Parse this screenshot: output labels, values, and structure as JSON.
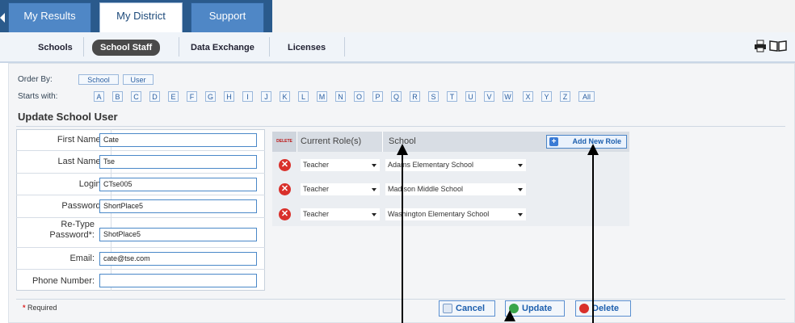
{
  "tabs": [
    {
      "label": "My Results",
      "active": false
    },
    {
      "label": "My District",
      "active": true
    },
    {
      "label": "Support",
      "active": false
    }
  ],
  "subnav": [
    "Schools",
    "School Staff",
    "Data Exchange",
    "Licenses"
  ],
  "subnav_active": "School Staff",
  "order_by": {
    "label": "Order By:",
    "options": [
      "School",
      "User"
    ]
  },
  "starts_with": {
    "label": "Starts with:",
    "letters": [
      "A",
      "B",
      "C",
      "D",
      "E",
      "F",
      "G",
      "H",
      "I",
      "J",
      "K",
      "L",
      "M",
      "N",
      "O",
      "P",
      "Q",
      "R",
      "S",
      "T",
      "U",
      "V",
      "W",
      "X",
      "Y",
      "Z",
      "All"
    ]
  },
  "section_title": "Update School User",
  "form": {
    "first_name": {
      "label": "First Name*:",
      "value": "Cate"
    },
    "last_name": {
      "label": "Last Name*:",
      "value": "Tse"
    },
    "login": {
      "label": "Login*:",
      "value": "CTse005"
    },
    "password": {
      "label": "Password*:",
      "value": "ShortPlace5"
    },
    "retype_line1": "Re-Type",
    "retype_line2": "Password*:",
    "retype_value": "ShotPlace5",
    "email": {
      "label": "Email:",
      "value": "cate@tse.com"
    },
    "phone": {
      "label": "Phone Number:",
      "value": ""
    }
  },
  "roles_table": {
    "delete_header": "DELETE",
    "role_header": "Current Role(s)",
    "school_header": "School",
    "add_role_label": "Add New Role",
    "rows": [
      {
        "role": "Teacher",
        "school": "Adams Elementary School"
      },
      {
        "role": "Teacher",
        "school": "Madison Middle School"
      },
      {
        "role": "Teacher",
        "school": "Washington Elementary School"
      }
    ]
  },
  "footer": {
    "required_mark": "*",
    "required_text": "Required",
    "cancel": "Cancel",
    "update": "Update",
    "delete": "Delete"
  },
  "colors": {
    "tab_blue": "#4f87c6",
    "link_blue": "#1d5fae",
    "delete_red": "#d9302b"
  }
}
